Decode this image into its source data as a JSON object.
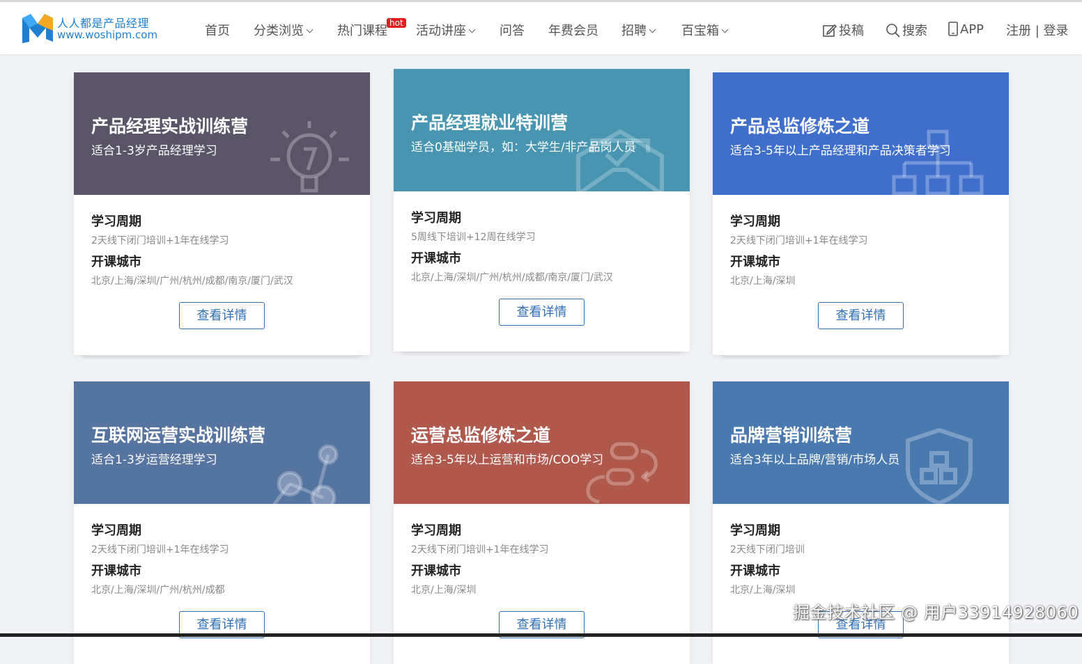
{
  "header": {
    "logo_title": "人人都是产品经理",
    "logo_url": "www.woshipm.com",
    "nav": [
      {
        "label": "首页",
        "caret": false
      },
      {
        "label": "分类浏览",
        "caret": true
      },
      {
        "label": "热门课程",
        "caret": false,
        "badge": "hot"
      },
      {
        "label": "活动讲座",
        "caret": true
      },
      {
        "label": "问答",
        "caret": false
      },
      {
        "label": "年费会员",
        "caret": false
      },
      {
        "label": "招聘",
        "caret": true
      },
      {
        "label": "百宝箱",
        "caret": true
      }
    ],
    "right": {
      "post": "投稿",
      "search": "搜索",
      "app": "APP",
      "auth": "注册 | 登录"
    }
  },
  "cards": [
    {
      "title": "产品经理实战训练营",
      "subtitle": "适合1-3岁产品经理学习",
      "color": "#5a5468",
      "icon": "lightbulb-icon",
      "period_label": "学习周期",
      "period": "2天线下闭门培训+1年在线学习",
      "city_label": "开课城市",
      "cities": "北京/上海/深圳/广州/杭州/成都/南京/厦门/武汉",
      "button": "查看详情"
    },
    {
      "title": "产品经理就业特训营",
      "subtitle": "适合0基础学员，如：大学生/非产品岗人员",
      "color": "#4795b1",
      "icon": "envelope-check-icon",
      "period_label": "学习周期",
      "period": "5周线下培训+12周在线学习",
      "city_label": "开课城市",
      "cities": "北京/上海/深圳/广州/杭州/成都/南京/厦门/武汉",
      "button": "查看详情"
    },
    {
      "title": "产品总监修炼之道",
      "subtitle": "适合3-5年以上产品经理和产品决策者学习",
      "color": "#3f6ecb",
      "icon": "org-chart-icon",
      "period_label": "学习周期",
      "period": "2天线下闭门培训+1年在线学习",
      "city_label": "开课城市",
      "cities": "北京/上海/深圳",
      "button": "查看详情"
    },
    {
      "title": "互联网运营实战训练营",
      "subtitle": "适合1-3岁运营经理学习",
      "color": "#5674a0",
      "icon": "molecule-icon",
      "period_label": "学习周期",
      "period": "2天线下闭门培训+1年在线学习",
      "city_label": "开课城市",
      "cities": "北京/上海/深圳/广州/杭州/成都",
      "button": "查看详情"
    },
    {
      "title": "运营总监修炼之道",
      "subtitle": "适合3-5年以上运营和市场/COO学习",
      "color": "#b0584c",
      "icon": "flow-cycle-icon",
      "period_label": "学习周期",
      "period": "2天线下闭门培训+1年在线学习",
      "city_label": "开课城市",
      "cities": "北京/上海/深圳",
      "button": "查看详情"
    },
    {
      "title": "品牌营销训练营",
      "subtitle": "适合3年以上品牌/营销/市场人员",
      "color": "#4a79b0",
      "icon": "shield-grid-icon",
      "period_label": "学习周期",
      "period": "2天线下闭门培训",
      "city_label": "开课城市",
      "cities": "北京/上海/深圳",
      "button": "查看详情"
    }
  ],
  "watermark": "掘金技术社区 @ 用户3391492806​0"
}
